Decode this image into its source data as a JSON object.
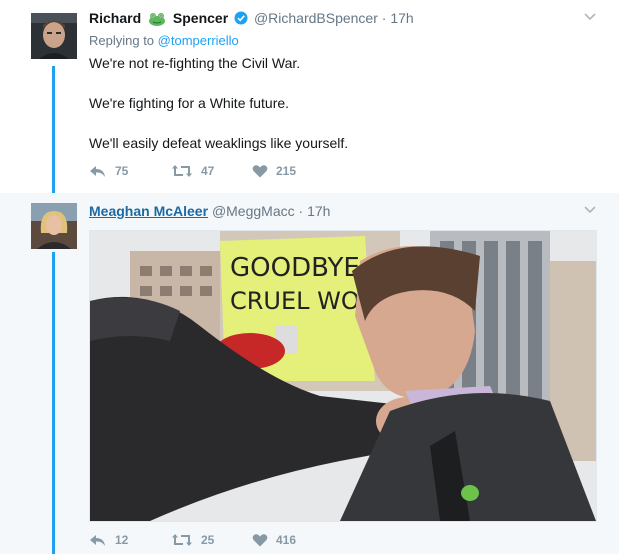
{
  "tweet1": {
    "name_first": "Richard",
    "name_last": "Spencer",
    "handle": "@RichardBSpencer",
    "separator": "·",
    "time": "17h",
    "replying_prefix": "Replying to",
    "replying_to": "@tomperriello",
    "lines": [
      "We're not re-fighting the Civil War.",
      "We're fighting for a White future.",
      "We'll easily defeat weaklings like yourself."
    ],
    "replies": "75",
    "retweets": "47",
    "likes": "215"
  },
  "tweet2": {
    "name": "Meaghan McAleer",
    "handle": "@MeggMacc",
    "separator": "·",
    "time": "17h",
    "sign_text_1": "GOODBYE",
    "sign_text_2": "CRUEL WOR",
    "replies": "12",
    "retweets": "25",
    "likes": "416"
  },
  "icons": [
    "green-frog-icon",
    "verified-badge-icon",
    "chevron-down-icon",
    "reply-icon",
    "retweet-icon",
    "heart-icon"
  ],
  "colors": {
    "thread_line": "#1da1f2",
    "link": "#1da1f2",
    "name_link": "#1b6aa5",
    "muted": "#657786",
    "action": "#8899a6",
    "verified": "#1da1f2",
    "frog": "#5cb85c",
    "sign_yellow": "#e4f07a"
  }
}
